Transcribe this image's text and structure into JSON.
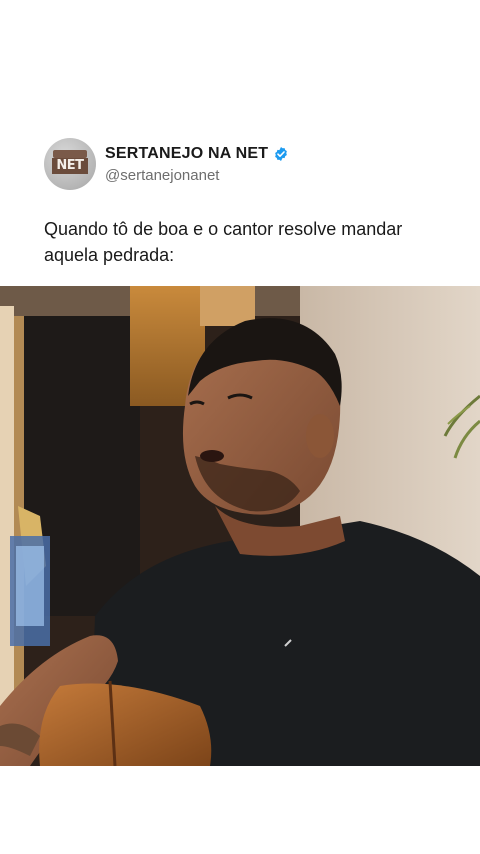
{
  "post": {
    "account_name": "SERTANEJO NA NET",
    "handle": "@sertanejonanet",
    "avatar_logo_text": "NET",
    "verified_icon": "verified-badge-icon",
    "caption": "Quando tô de boa e o cantor resolve mandar aquela pedrada:"
  },
  "colors": {
    "background": "#ffffff",
    "verified": "#1d9bf0",
    "text_primary": "#1a1a1a",
    "text_secondary": "#6e6e6e"
  }
}
